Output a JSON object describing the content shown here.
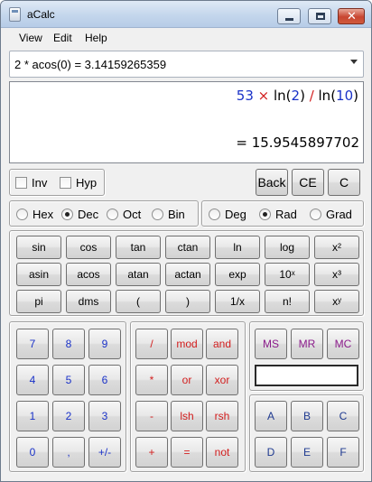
{
  "window": {
    "title": "aCalc"
  },
  "menu": [
    "View",
    "Edit",
    "Help"
  ],
  "history_combo": {
    "value": "2 * acos(0) = 3.14159265359"
  },
  "display": {
    "expression": [
      {
        "t": "53",
        "k": "num"
      },
      {
        "t": " × ",
        "k": "op"
      },
      {
        "t": "ln(",
        "k": "fn"
      },
      {
        "t": "2",
        "k": "num"
      },
      {
        "t": ")",
        "k": "fn"
      },
      {
        "t": " / ",
        "k": "op"
      },
      {
        "t": "ln(",
        "k": "fn"
      },
      {
        "t": "10",
        "k": "num"
      },
      {
        "t": ")",
        "k": "fn"
      }
    ],
    "result": "= 15.9545897702"
  },
  "options": {
    "inv": "Inv",
    "hyp": "Hyp"
  },
  "edit_buttons": {
    "back": "Back",
    "ce": "CE",
    "c": "C"
  },
  "base": {
    "options": [
      "Hex",
      "Dec",
      "Oct",
      "Bin"
    ],
    "selected": "Dec"
  },
  "angle": {
    "options": [
      "Deg",
      "Rad",
      "Grad"
    ],
    "selected": "Rad"
  },
  "functions": [
    [
      "sin",
      "cos",
      "tan",
      "ctan",
      "ln",
      "log",
      "x²"
    ],
    [
      "asin",
      "acos",
      "atan",
      "actan",
      "exp",
      "10ˣ",
      "x³"
    ],
    [
      "pi",
      "dms",
      "(",
      ")",
      "1/x",
      "n!",
      "xʸ"
    ]
  ],
  "digits": [
    [
      "7",
      "8",
      "9"
    ],
    [
      "4",
      "5",
      "6"
    ],
    [
      "1",
      "2",
      "3"
    ],
    [
      "0",
      ",",
      "+/-"
    ]
  ],
  "operators": [
    [
      "/",
      "mod",
      "and"
    ],
    [
      "*",
      "or",
      "xor"
    ],
    [
      "-",
      "lsh",
      "rsh"
    ],
    [
      "+",
      "=",
      "not"
    ]
  ],
  "memory": [
    "MS",
    "MR",
    "MC"
  ],
  "memory_value": "",
  "hex_digits": [
    [
      "A",
      "B",
      "C"
    ],
    [
      "D",
      "E",
      "F"
    ]
  ],
  "colors": {
    "digit": "#1a32c8",
    "operator": "#d21e1e",
    "memory": "#8a1a8a",
    "hex": "#1f3a90"
  }
}
